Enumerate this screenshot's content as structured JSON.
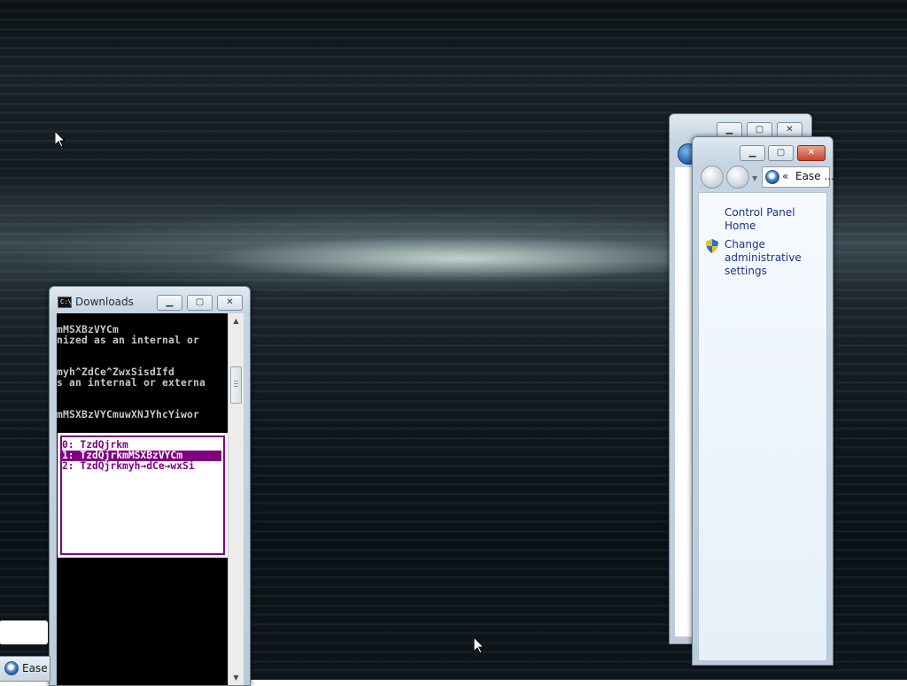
{
  "console": {
    "title": "Downloads",
    "title_icon_text": "C:\\.",
    "lines": [
      "mMSXBzVYCm",
      "nized as an internal or",
      "myh^ZdCe^ZwxSisdIfd",
      "s an internal or externa",
      "mMSXBzVYCmuwXNJYhcYiwor"
    ],
    "menu": [
      "0: TzdQjrkm",
      "1: TzdQjrkmMSXBzVYCm",
      "2: TzdQjrkmyh→dCe→wxSi"
    ],
    "selected_index": 1
  },
  "explorer": {
    "address_chevron": "«",
    "address_text": "Ease ...",
    "links": {
      "home": "Control Panel Home",
      "admin": "Change administrative settings"
    }
  },
  "taskbar": {
    "ease_label": "Ease"
  },
  "colors": {
    "menu_purple": "#800080",
    "link_blue": "#1e3287"
  }
}
